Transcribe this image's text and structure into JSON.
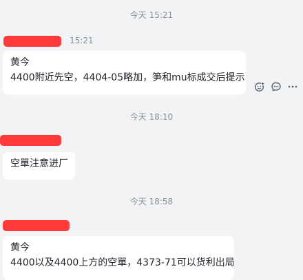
{
  "timestamps": [
    "今天 15:21",
    "今天 18:10",
    "今天 18:58"
  ],
  "messages": [
    {
      "sender_redacted": true,
      "time": "15:21",
      "lines": [
        "黄今",
        "4400附近先空，4404-05略加，笋和mu标成交后提示"
      ]
    },
    {
      "sender_redacted": true,
      "lines": [
        "空單注意进厂"
      ]
    },
    {
      "sender_redacted": true,
      "lines": [
        "黄今",
        "4400以及4400上方的空單，4373-71可以货利出局"
      ]
    }
  ],
  "message_actions": [
    {
      "icon": "emoji-reaction-icon"
    },
    {
      "icon": "reply-comment-icon"
    },
    {
      "icon": "more-options-icon"
    }
  ],
  "colors": {
    "background": "#f2f3f5",
    "bubble": "#ffffff",
    "redaction": "#ff3b3b",
    "meta_text": "#8a8f99",
    "body_text": "#1f2329"
  }
}
